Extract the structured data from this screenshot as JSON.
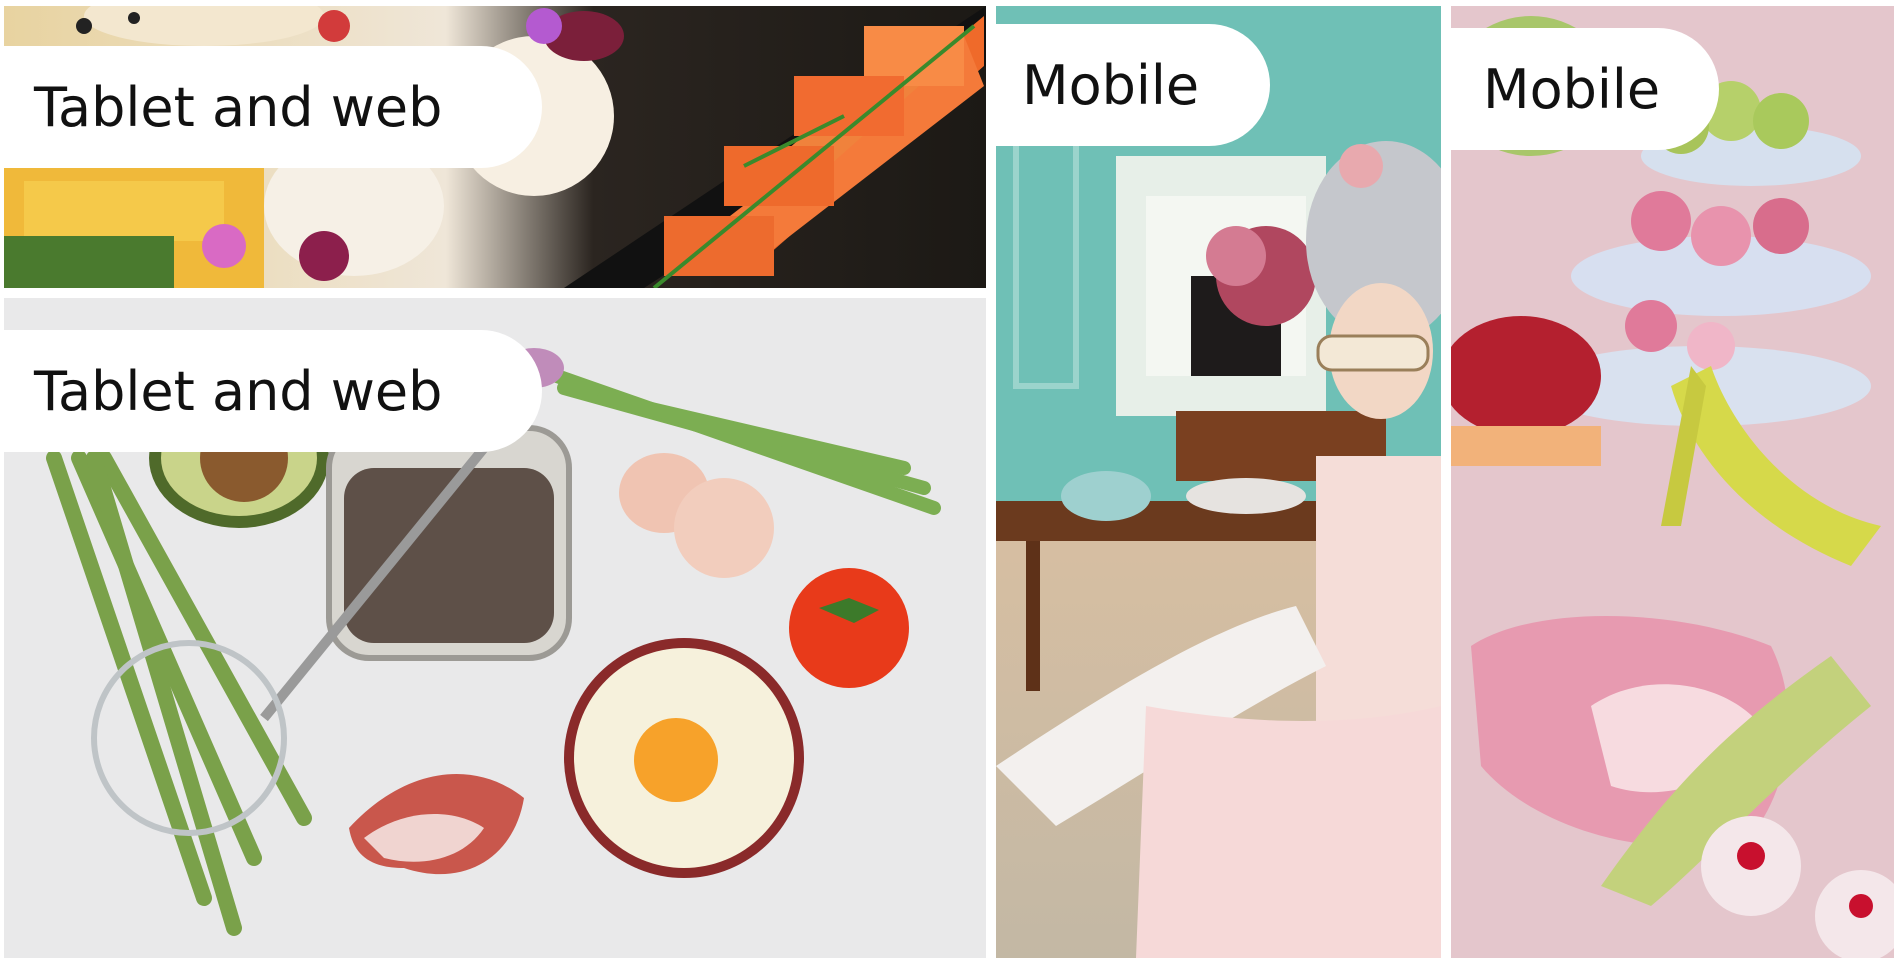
{
  "tiles": [
    {
      "label": "Tablet and web"
    },
    {
      "label": "Tablet and web"
    },
    {
      "label": "Mobile"
    },
    {
      "label": "Mobile"
    }
  ],
  "images": [
    "canapes-photo",
    "breakfast-ingredients-photo",
    "painting-woman-in-sunglasses",
    "painting-macarons-and-shoes"
  ]
}
